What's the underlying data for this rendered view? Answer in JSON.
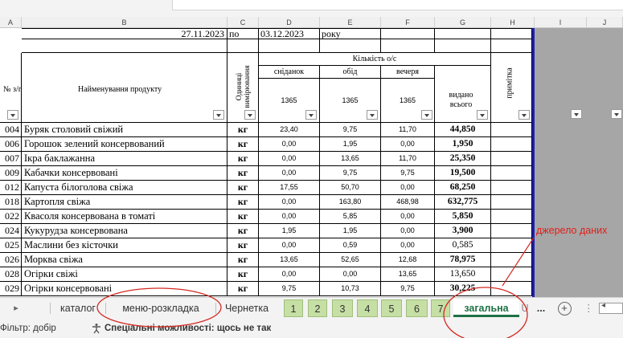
{
  "columns": [
    "A",
    "B",
    "C",
    "D",
    "E",
    "F",
    "G",
    "H",
    "I",
    "J"
  ],
  "period": {
    "start": "27.11.2023",
    "to": "по",
    "end": "03.12.2023",
    "year_word": "року"
  },
  "headers": {
    "num": "№ з/п",
    "name": "Найменування продукту",
    "unit": "Одиниці вимірювання",
    "qty_group": "Кількість о/с",
    "breakfast": "сніданок",
    "lunch": "обід",
    "dinner": "вечеря",
    "count": "1365",
    "total": "видано всього",
    "note": "примітка"
  },
  "rows": [
    {
      "code": "004",
      "name": "Буряк столовий свіжий",
      "unit": "кг",
      "b": "23,40",
      "l": "9,75",
      "d": "11,70",
      "t": "44,850",
      "tb": true
    },
    {
      "code": "006",
      "name": "Горошок зелений консервований",
      "unit": "кг",
      "b": "0,00",
      "l": "1,95",
      "d": "0,00",
      "t": "1,950",
      "tb": true
    },
    {
      "code": "007",
      "name": "Ікра баклажанна",
      "unit": "кг",
      "b": "0,00",
      "l": "13,65",
      "d": "11,70",
      "t": "25,350",
      "tb": true
    },
    {
      "code": "009",
      "name": "Кабачки консервовані",
      "unit": "кг",
      "b": "0,00",
      "l": "9,75",
      "d": "9,75",
      "t": "19,500",
      "tb": true
    },
    {
      "code": "012",
      "name": "Капуста білоголова свіжа",
      "unit": "кг",
      "b": "17,55",
      "l": "50,70",
      "d": "0,00",
      "t": "68,250",
      "tb": true
    },
    {
      "code": "018",
      "name": "Картопля свіжа",
      "unit": "кг",
      "b": "0,00",
      "l": "163,80",
      "d": "468,98",
      "t": "632,775",
      "tb": true
    },
    {
      "code": "022",
      "name": "Квасоля консервована в томаті",
      "unit": "кг",
      "b": "0,00",
      "l": "5,85",
      "d": "0,00",
      "t": "5,850",
      "tb": true
    },
    {
      "code": "024",
      "name": "Кукурудза консервована",
      "unit": "кг",
      "b": "1,95",
      "l": "1,95",
      "d": "0,00",
      "t": "3,900",
      "tb": true
    },
    {
      "code": "025",
      "name": "Маслини без кісточки",
      "unit": "кг",
      "b": "0,00",
      "l": "0,59",
      "d": "0,00",
      "t": "0,585",
      "tb": false
    },
    {
      "code": "026",
      "name": "Морква свіжа",
      "unit": "кг",
      "b": "13,65",
      "l": "52,65",
      "d": "12,68",
      "t": "78,975",
      "tb": true
    },
    {
      "code": "028",
      "name": "Огірки свіжі",
      "unit": "кг",
      "b": "0,00",
      "l": "0,00",
      "d": "13,65",
      "t": "13,650",
      "tb": false
    },
    {
      "code": "029",
      "name": "Огірки консервовані",
      "unit": "кг",
      "b": "9,75",
      "l": "10,73",
      "d": "9,75",
      "t": "30,225",
      "tb": true
    }
  ],
  "tabs": {
    "catalog": "каталог",
    "menu": "меню-розкладка",
    "draft": "Чернетка",
    "nums": [
      "1",
      "2",
      "3",
      "4",
      "5",
      "6",
      "7"
    ],
    "general": "загальна",
    "more": "...",
    "add": "+"
  },
  "status": {
    "filter": "Фільтр: добір",
    "accessibility": "Спеціальні можливості: щось не так"
  },
  "annotation": "джерело даних",
  "colors": {
    "accent": "#1e7145",
    "annotation": "#e0201b",
    "green_tab": "#c6dfa4",
    "border_blue": "#1f1fb4"
  }
}
